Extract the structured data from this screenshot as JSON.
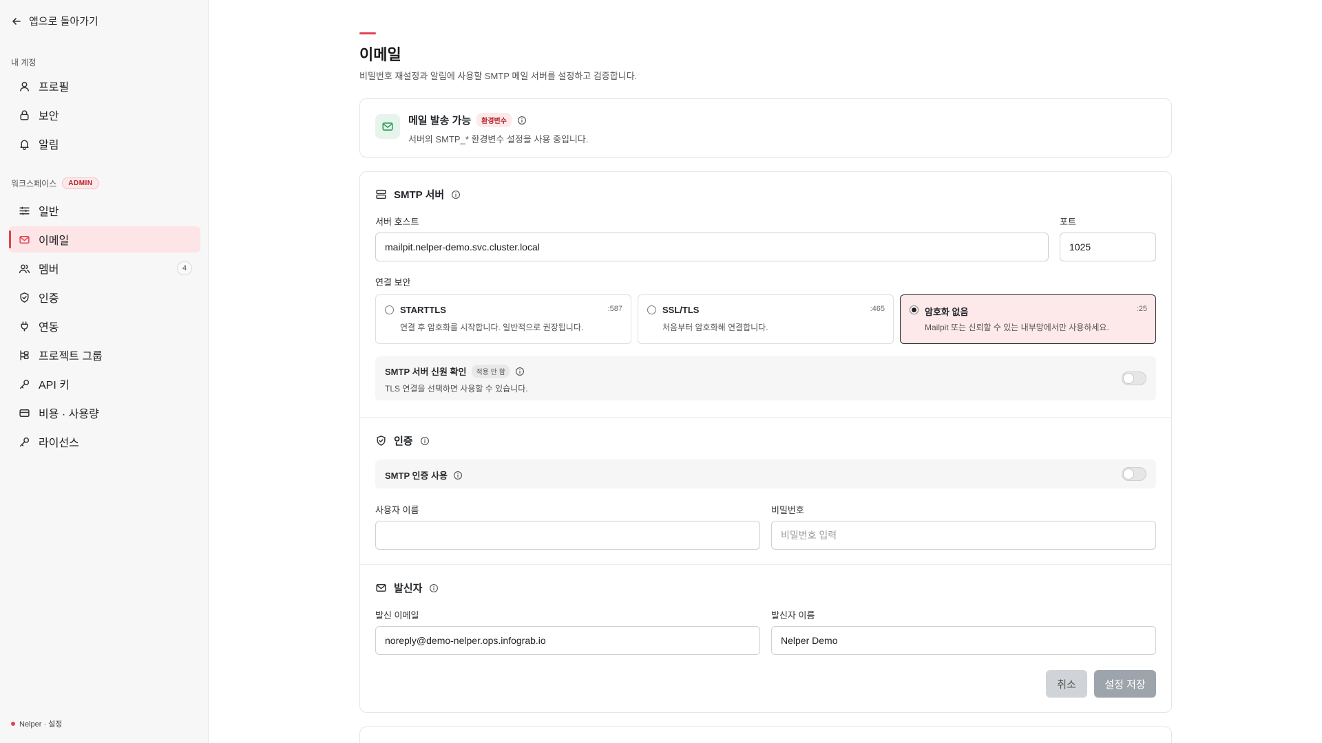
{
  "sidebar": {
    "back_label": "앱으로 돌아가기",
    "account_section": "내 계정",
    "account_items": [
      {
        "label": "프로필",
        "icon": "user-icon"
      },
      {
        "label": "보안",
        "icon": "lock-icon"
      },
      {
        "label": "알림",
        "icon": "bell-icon"
      }
    ],
    "workspace_section": "워크스페이스",
    "workspace_badge": "ADMIN",
    "workspace_items": [
      {
        "label": "일반",
        "icon": "sliders-icon"
      },
      {
        "label": "이메일",
        "icon": "mail-icon",
        "active": true
      },
      {
        "label": "멤버",
        "icon": "users-icon",
        "count": "4"
      },
      {
        "label": "인증",
        "icon": "shield-icon"
      },
      {
        "label": "연동",
        "icon": "plug-icon"
      },
      {
        "label": "프로젝트 그룹",
        "icon": "group-icon"
      },
      {
        "label": "API 키",
        "icon": "key-icon"
      },
      {
        "label": "비용 · 사용량",
        "icon": "card-icon"
      },
      {
        "label": "라이선스",
        "icon": "license-key-icon"
      }
    ],
    "footer": "Nelper · 설정"
  },
  "main": {
    "title": "이메일",
    "description": "비밀번호 재설정과 알림에 사용할 SMTP 메일 서버를 설정하고 검증합니다.",
    "status": {
      "title": "메일 발송 가능",
      "tag": "환경변수",
      "description": "서버의 SMTP_* 환경변수 설정을 사용 중입니다."
    },
    "smtp": {
      "title": "SMTP 서버",
      "host_label": "서버 호스트",
      "host_value": "mailpit.nelper-demo.svc.cluster.local",
      "port_label": "포트",
      "port_value": "1025",
      "security_label": "연결 보안",
      "options": [
        {
          "title": "STARTTLS",
          "port": ":587",
          "desc": "연결 후 암호화를 시작합니다. 일반적으로 권장됩니다.",
          "selected": false
        },
        {
          "title": "SSL/TLS",
          "port": ":465",
          "desc": "처음부터 암호화해 연결합니다.",
          "selected": false
        },
        {
          "title": "암호화 없음",
          "port": ":25",
          "desc": "Mailpit 또는 신뢰할 수 있는 내부망에서만 사용하세요.",
          "selected": true
        }
      ],
      "trust_title": "SMTP 서버 신원 확인",
      "trust_tag": "적용 안 함",
      "trust_desc": "TLS 연결을 선택하면 사용할 수 있습니다."
    },
    "auth": {
      "title": "인증",
      "toggle_label": "SMTP 인증 사용",
      "username_label": "사용자 이름",
      "username_value": "",
      "password_label": "비밀번호",
      "password_placeholder": "비밀번호 입력"
    },
    "sender": {
      "title": "발신자",
      "email_label": "발신 이메일",
      "email_value": "noreply@demo-nelper.ops.infograb.io",
      "name_label": "발신자 이름",
      "name_value": "Nelper Demo"
    },
    "actions": {
      "cancel": "취소",
      "save": "설정 저장"
    }
  },
  "colors": {
    "accent": "#e0434f",
    "active_bg": "#fde4e6",
    "success_icon": "#2f9e5b"
  }
}
